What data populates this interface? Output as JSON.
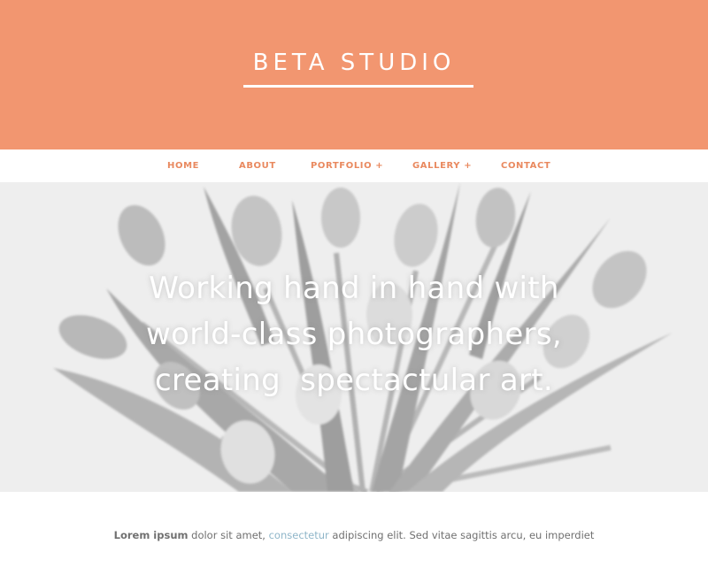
{
  "header": {
    "logo": "BETA STUDIO",
    "background_color": "#f29670"
  },
  "nav": {
    "items": [
      {
        "label": "HOME"
      },
      {
        "label": "ABOUT"
      },
      {
        "label": "PORTFOLIO +"
      },
      {
        "label": "GALLERY +"
      },
      {
        "label": "CONTACT"
      }
    ],
    "color": "#e9895f"
  },
  "hero": {
    "line1": "Working hand in hand with",
    "line2": "world-class photographers,",
    "line3": "creating  spectactular art."
  },
  "content": {
    "bold": "Lorem ipsum",
    "text1": " dolor sit amet, ",
    "link": "consectetur",
    "text2": " adipiscing elit. Sed vitae sagittis arcu, eu imperdiet"
  }
}
